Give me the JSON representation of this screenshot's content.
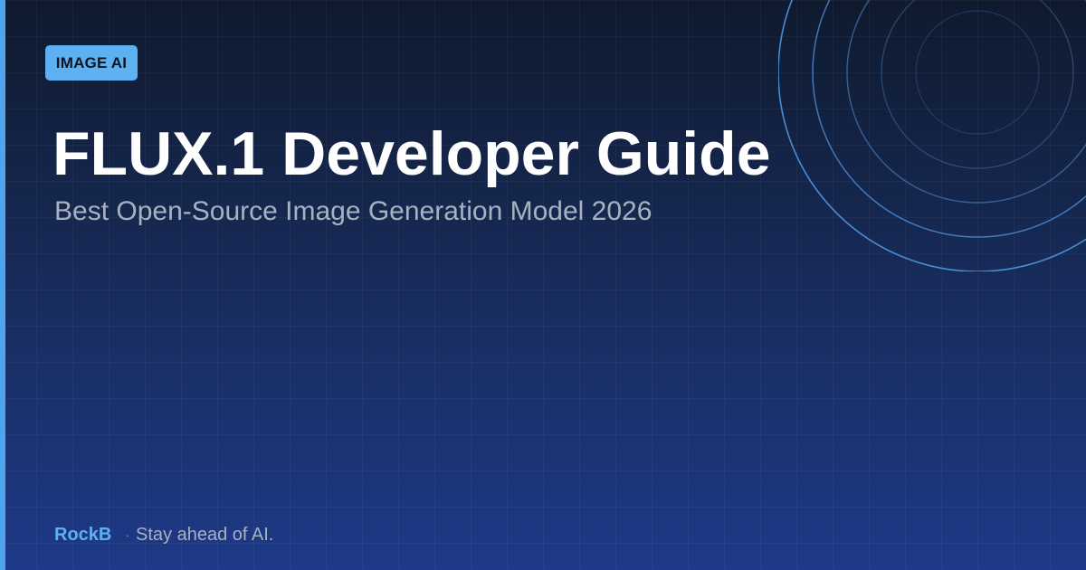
{
  "badge": {
    "label": "IMAGE AI"
  },
  "headline": {
    "title": "FLUX.1 Developer Guide",
    "subtitle": "Best Open-Source Image Generation Model 2026"
  },
  "footer": {
    "brand": "RockB",
    "separator": "·",
    "tagline": "Stay ahead of AI."
  },
  "colors": {
    "background_top": "#0f1a2e",
    "background_bottom": "#1e3a88",
    "accent": "#5eb1f0",
    "title": "#ffffff",
    "subtitle": "#a8b1c0"
  },
  "decorations": {
    "left_bar": "accent-bar",
    "rings": "concentric-rings"
  }
}
